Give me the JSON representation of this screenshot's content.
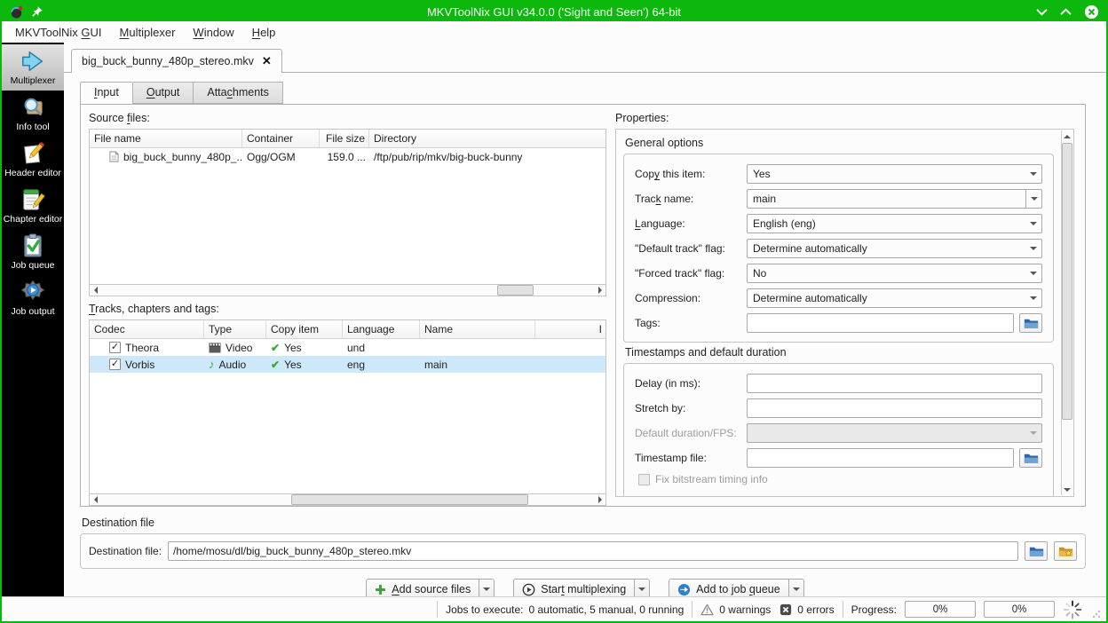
{
  "window": {
    "title": "MKVToolNix GUI v34.0.0 ('Sight and Seen') 64-bit"
  },
  "menu": {
    "items": [
      {
        "pre": "MKVToolNix ",
        "u": "G",
        "post": "UI"
      },
      {
        "pre": "",
        "u": "M",
        "post": "ultiplexer"
      },
      {
        "pre": "",
        "u": "W",
        "post": "indow"
      },
      {
        "pre": "",
        "u": "H",
        "post": "elp"
      }
    ]
  },
  "sidebar": {
    "items": [
      {
        "label": "Multiplexer"
      },
      {
        "label": "Info tool"
      },
      {
        "label": "Header editor"
      },
      {
        "label": "Chapter editor"
      },
      {
        "label": "Job queue"
      },
      {
        "label": "Job output"
      }
    ]
  },
  "doc_tab": {
    "label": "big_buck_bunny_480p_stereo.mkv",
    "close": "✕"
  },
  "tabs": {
    "input": {
      "pre": "",
      "u": "I",
      "post": "nput"
    },
    "output": {
      "pre": "",
      "u": "O",
      "post": "utput"
    },
    "attachments": {
      "pre": "Atta",
      "u": "c",
      "post": "hments"
    }
  },
  "source_files": {
    "label": {
      "pre": "Source ",
      "u": "f",
      "post": "iles:"
    },
    "columns": {
      "file_name": "File name",
      "container": "Container",
      "file_size": "File size",
      "directory": "Directory"
    },
    "rows": [
      {
        "file_name": "big_buck_bunny_480p_...",
        "container": "Ogg/OGM",
        "file_size": "159.0 ...",
        "directory": "/ftp/pub/rip/mkv/big-buck-bunny"
      }
    ]
  },
  "tracks": {
    "label": {
      "pre": "",
      "u": "T",
      "post": "racks, chapters and tags:"
    },
    "columns": {
      "codec": "Codec",
      "type": "Type",
      "copy_item": "Copy item",
      "language": "Language",
      "name": "Name",
      "id": "I"
    },
    "rows": [
      {
        "checked": "✓",
        "codec": "Theora",
        "type": "Video",
        "copy_mark": "✔",
        "copy_item": "Yes",
        "language": "und",
        "name": ""
      },
      {
        "checked": "✓",
        "codec": "Vorbis",
        "type": "Audio",
        "copy_mark": "✔",
        "copy_item": "Yes",
        "language": "eng",
        "name": "main"
      }
    ]
  },
  "properties": {
    "label": "Properties:",
    "general": {
      "title": "General options",
      "copy_this_item": {
        "label": {
          "pre": "Cop",
          "u": "y",
          "post": " this item:"
        },
        "value": "Yes"
      },
      "track_name": {
        "label": {
          "pre": "Trac",
          "u": "k",
          "post": " name:"
        },
        "value": "main"
      },
      "language": {
        "label": {
          "pre": "",
          "u": "L",
          "post": "anguage:"
        },
        "value": "English (eng)"
      },
      "default_track_flag": {
        "label": "\"Default track\" flag:",
        "value": "Determine automatically"
      },
      "forced_track_flag": {
        "label": "\"Forced track\" flag:",
        "value": "No"
      },
      "compression": {
        "label": "Compression:",
        "value": "Determine automatically"
      },
      "tags": {
        "label": "Tags:",
        "value": ""
      }
    },
    "timestamps": {
      "title": "Timestamps and default duration",
      "delay": {
        "label": "Delay (in ms):",
        "value": ""
      },
      "stretch_by": {
        "label": "Stretch by:",
        "value": ""
      },
      "default_duration": {
        "label": "Default duration/FPS:",
        "value": ""
      },
      "timestamp_file": {
        "label": "Timestamp file:",
        "value": ""
      },
      "fix_bitstream": {
        "label": "Fix bitstream timing info"
      }
    }
  },
  "destination": {
    "group_title": "Destination file",
    "label": "Destination file:",
    "value": "/home/mosu/dl/big_buck_bunny_480p_stereo.mkv"
  },
  "actions": {
    "add_source_files": {
      "pre": "",
      "u": "A",
      "post": "dd source files"
    },
    "start_multiplexing": {
      "pre": "Star",
      "u": "t",
      "post": " multiplexing"
    },
    "add_to_job_queue": {
      "pre": "Add to job ",
      "u": "q",
      "post": "ueue"
    }
  },
  "statusbar": {
    "jobs_label": "Jobs to execute:",
    "jobs_value": "0 automatic, 5 manual, 0 running",
    "warnings": "0 warnings",
    "errors": "0 errors",
    "progress_label": "Progress:",
    "progress1": "0%",
    "progress2": "0%"
  },
  "colors": {
    "titlebar_green": "#0db80d",
    "selection_blue": "#cde8fb",
    "ok_green": "#3aa53a"
  }
}
